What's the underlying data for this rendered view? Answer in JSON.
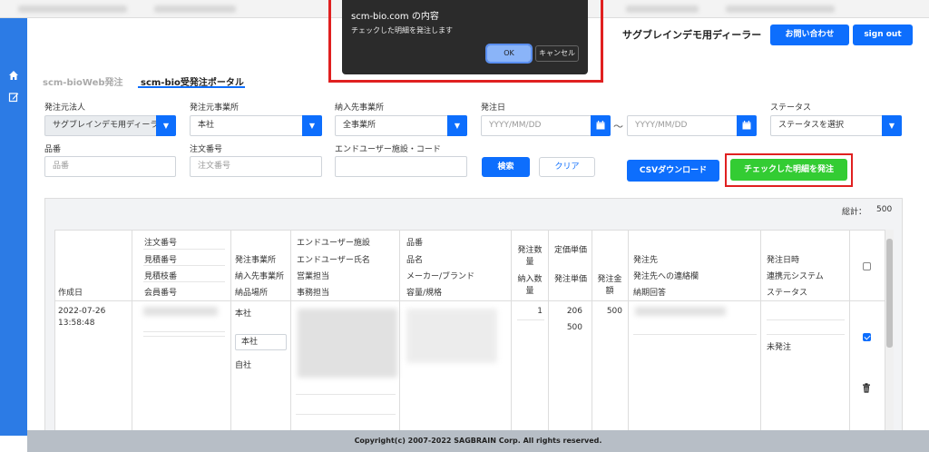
{
  "header": {
    "dealer_name": "サグブレインデモ用ディーラー",
    "contact_label": "お問い合わせ",
    "signout_label": "sign out"
  },
  "tabs": [
    {
      "label": "scm-bioWeb発注",
      "active": false
    },
    {
      "label": "scm-bio受発注ポータル",
      "active": true
    }
  ],
  "filters": {
    "ordering_corp_label": "発注元法人",
    "ordering_corp_value": "サグブレインデモ用ディーラ",
    "ordering_office_label": "発注元事業所",
    "ordering_office_value": "本社",
    "delivery_office_label": "納入先事業所",
    "delivery_office_value": "全事業所",
    "order_date_label": "発注日",
    "date_from_placeholder": "YYYY/MM/DD",
    "date_to_placeholder": "YYYY/MM/DD",
    "date_separator": "～",
    "status_label": "ステータス",
    "status_value": "ステータスを選択",
    "item_code_label": "品番",
    "item_code_placeholder": "品番",
    "order_no_label": "注文番号",
    "order_no_placeholder": "注文番号",
    "end_user_label": "エンドユーザー施設・コード",
    "end_user_value": ""
  },
  "actions": {
    "search_label": "検索",
    "clear_label": "クリア",
    "csv_label": "CSVダウンロード",
    "order_checked_label": "チェックした明細を発注"
  },
  "results": {
    "total_label": "総計：",
    "total_value": "500",
    "headers": {
      "created": "作成日",
      "order_no": "注文番号",
      "quote_no": "見積番号",
      "quote_branch": "見積枝番",
      "member_no": "会員番号",
      "ordering_office": "発注事業所",
      "delivery_office": "納入先事業所",
      "delivery_place": "納品場所",
      "end_user_facility": "エンドユーザー施設",
      "end_user_name": "エンドユーザー氏名",
      "sales_rep": "営業担当",
      "admin_rep": "事務担当",
      "item_code": "品番",
      "item_name": "品名",
      "maker_brand": "メーカー/ブランド",
      "capacity_spec": "容量/規格",
      "order_qty": "発注数量",
      "delivery_qty": "納入数量",
      "list_price": "定価単価",
      "order_price": "発注単価",
      "order_amount": "発注金額",
      "supplier": "発注先",
      "supplier_note": "発注先への連絡欄",
      "delivery_reply": "納期回答",
      "order_datetime": "発注日時",
      "link_system": "連携元システム",
      "status": "ステータス"
    },
    "row": {
      "created_date": "2022-07-26",
      "created_time": "13:58:48",
      "ordering_office": "本社",
      "delivery_office": "本社",
      "delivery_place": "自社",
      "order_qty": "1",
      "list_price": "206",
      "order_price": "500",
      "order_amount": "500",
      "status": "未発注",
      "checked": true
    }
  },
  "footer": {
    "copyright": "Copyright(c) 2007-2022 SAGBRAIN Corp. All rights reserved."
  },
  "dialog": {
    "title": "scm-bio.com の内容",
    "message": "チェックした明細を発注します",
    "ok_label": "OK",
    "cancel_label": "キャンセル"
  },
  "colors": {
    "primary": "#0d6efd",
    "sidebar": "#2c7be5",
    "order_button": "#33cc33",
    "highlight_box": "#e02020",
    "footer": "#b7bec6"
  }
}
